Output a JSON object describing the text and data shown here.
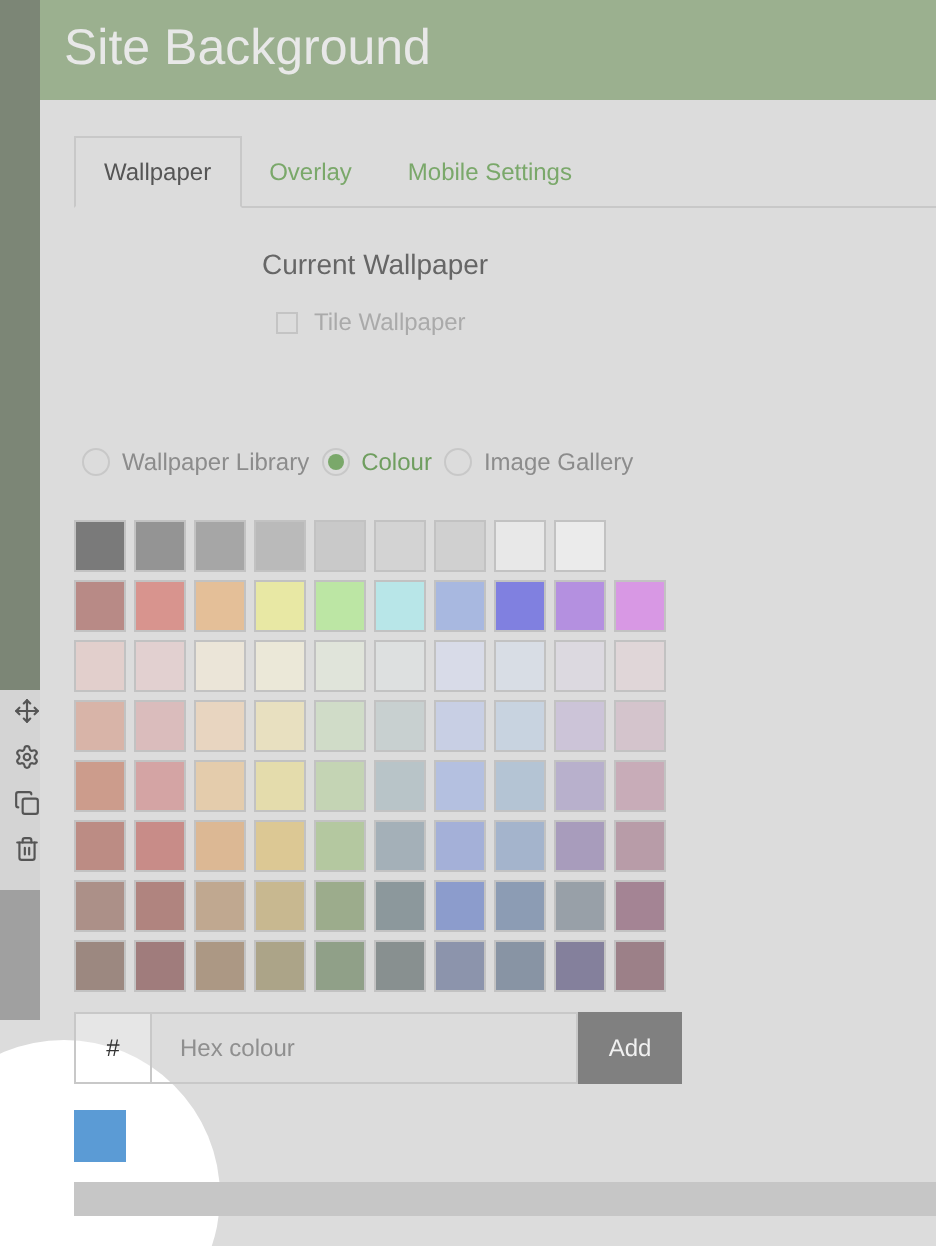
{
  "header": {
    "title": "Site Background"
  },
  "tabs": [
    {
      "label": "Wallpaper",
      "selected": true
    },
    {
      "label": "Overlay",
      "selected": false
    },
    {
      "label": "Mobile Settings",
      "selected": false
    }
  ],
  "current_wallpaper": {
    "heading": "Current Wallpaper",
    "tile": {
      "label": "Tile Wallpaper",
      "checked": false
    }
  },
  "source": [
    {
      "label": "Wallpaper Library",
      "selected": false
    },
    {
      "label": "Colour",
      "selected": true
    },
    {
      "label": "Image Gallery",
      "selected": false
    }
  ],
  "swatch_rows": [
    [
      {
        "color": "#7a7a7a"
      },
      {
        "color": "#949494"
      },
      {
        "color": "#a6a6a6"
      },
      {
        "color": "#bababa"
      },
      {
        "color": "#c9c9c9"
      },
      {
        "color": "#d3d3d3"
      },
      {
        "color": "#d0d0d0"
      },
      {
        "color": "#e8e8e8"
      },
      {
        "color": "#ebebeb"
      }
    ],
    [
      {
        "color": "#b88a86"
      },
      {
        "color": "#d8948e"
      },
      {
        "color": "#e4bf98"
      },
      {
        "color": "#e8e8a4"
      },
      {
        "color": "#bce6a4"
      },
      {
        "color": "#b8e6e8"
      },
      {
        "color": "#a8b8e0"
      },
      {
        "color": "#8080e0"
      },
      {
        "color": "#b490e0"
      },
      {
        "color": "#d898e4"
      }
    ],
    [
      {
        "color": "#e2cfcc"
      },
      {
        "color": "#e2d0d0"
      },
      {
        "color": "#ebe5d8"
      },
      {
        "color": "#ebe8d8"
      },
      {
        "color": "#e0e4da"
      },
      {
        "color": "#dde0e0"
      },
      {
        "color": "#d8dbe8"
      },
      {
        "color": "#d8dde5"
      },
      {
        "color": "#dcd9e0"
      },
      {
        "color": "#e0d6d8"
      }
    ],
    [
      {
        "color": "#d8b4a8"
      },
      {
        "color": "#dabcbc"
      },
      {
        "color": "#e8d5c0"
      },
      {
        "color": "#e8e0c0"
      },
      {
        "color": "#d0dcc8"
      },
      {
        "color": "#c8d0d0"
      },
      {
        "color": "#c8cfe4"
      },
      {
        "color": "#c8d3e0"
      },
      {
        "color": "#ccc4d8"
      },
      {
        "color": "#d4c4cc"
      }
    ],
    [
      {
        "color": "#cc9c8c"
      },
      {
        "color": "#d4a4a4"
      },
      {
        "color": "#e4ccac"
      },
      {
        "color": "#e4dcac"
      },
      {
        "color": "#c4d4b4"
      },
      {
        "color": "#b8c4c8"
      },
      {
        "color": "#b4c0e0"
      },
      {
        "color": "#b4c4d4"
      },
      {
        "color": "#b8b0cc"
      },
      {
        "color": "#c8acb8"
      }
    ],
    [
      {
        "color": "#bc8c84"
      },
      {
        "color": "#c88c88"
      },
      {
        "color": "#dcb894"
      },
      {
        "color": "#dcc894"
      },
      {
        "color": "#b4c8a0"
      },
      {
        "color": "#a4b0b8"
      },
      {
        "color": "#a4b0d8"
      },
      {
        "color": "#a4b4cc"
      },
      {
        "color": "#a89cbc"
      },
      {
        "color": "#b89ca8"
      }
    ],
    [
      {
        "color": "#ac9088"
      },
      {
        "color": "#b0847f"
      },
      {
        "color": "#c0a890"
      },
      {
        "color": "#c8b890"
      },
      {
        "color": "#9cac8c"
      },
      {
        "color": "#8c989c"
      },
      {
        "color": "#8c9ccc"
      },
      {
        "color": "#8c9cb4"
      },
      {
        "color": "#98a0a8"
      },
      {
        "color": "#a48494"
      }
    ],
    [
      {
        "color": "#9c8880"
      },
      {
        "color": "#a07c7c"
      },
      {
        "color": "#ac9884"
      },
      {
        "color": "#aca488"
      },
      {
        "color": "#90a088"
      },
      {
        "color": "#889090"
      },
      {
        "color": "#8c94ac"
      },
      {
        "color": "#8894a4"
      },
      {
        "color": "#84809c"
      },
      {
        "color": "#9c8088"
      }
    ]
  ],
  "hex_input": {
    "prefix": "#",
    "placeholder": "Hex colour",
    "button": "Add"
  },
  "custom_colours": [
    {
      "color": "#5b9bd5"
    }
  ]
}
